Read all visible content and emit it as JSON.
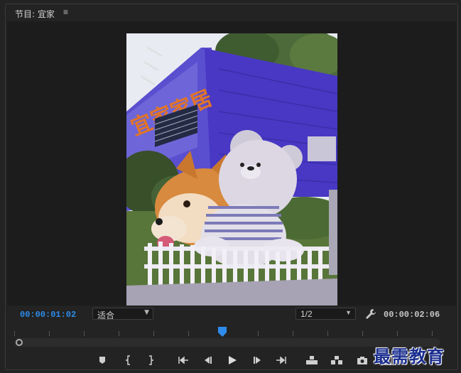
{
  "panel": {
    "title": "节目: 宜家",
    "menu_icon": "hamburger-icon"
  },
  "preview": {
    "sign_text": "宜家家居",
    "description_colors": {
      "building": "#4a3fc8",
      "sky": "#e8eaf0",
      "grass": "#5e7a3a",
      "fence": "#e6e6ee"
    }
  },
  "controls": {
    "current_time": "00:00:01:02",
    "duration": "00:00:02:06",
    "fit_label": "适合",
    "resolution_label": "1/2",
    "settings_icon": "wrench-icon",
    "accent": "#2d8ceb"
  },
  "transport": [
    {
      "name": "add-marker-button",
      "icon": "marker-icon"
    },
    {
      "name": "mark-in-button",
      "icon": "mark-in-icon"
    },
    {
      "name": "mark-out-button",
      "icon": "mark-out-icon"
    },
    {
      "name": "go-to-in-button",
      "icon": "go-to-in-icon"
    },
    {
      "name": "step-back-button",
      "icon": "step-back-icon"
    },
    {
      "name": "play-button",
      "icon": "play-icon"
    },
    {
      "name": "step-forward-button",
      "icon": "step-forward-icon"
    },
    {
      "name": "go-to-out-button",
      "icon": "go-to-out-icon"
    },
    {
      "name": "lift-button",
      "icon": "lift-icon"
    },
    {
      "name": "extract-button",
      "icon": "extract-icon"
    },
    {
      "name": "export-frame-button",
      "icon": "camera-icon"
    },
    {
      "name": "compare-button",
      "icon": "film-icon"
    },
    {
      "name": "button-editor",
      "icon": "plus-icon"
    }
  ],
  "playback": {
    "position_fraction": 0.49
  },
  "watermark": {
    "text": "最需教育"
  }
}
